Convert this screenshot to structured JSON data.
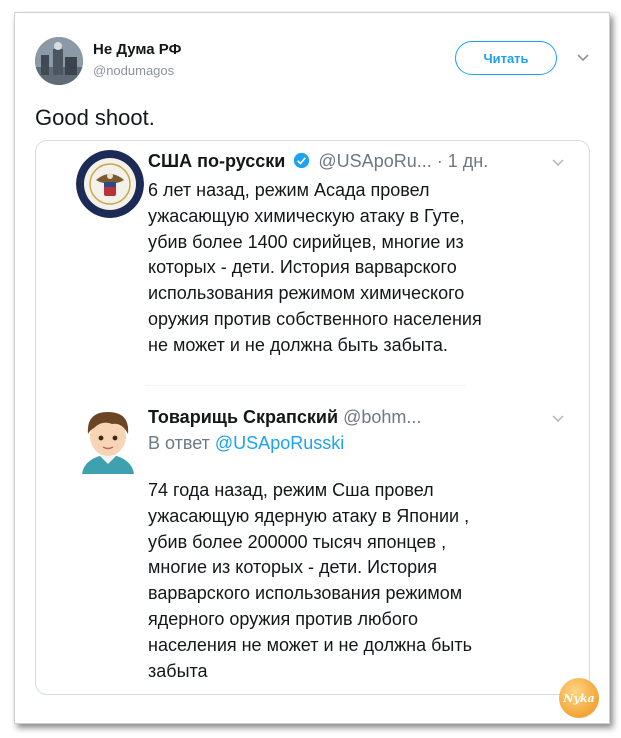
{
  "author": {
    "name": "Не Дума РФ",
    "handle": "@nodumagos"
  },
  "follow_button": {
    "label": "Читать"
  },
  "tweet": {
    "text": "Good shoot."
  },
  "quoted_tweet": {
    "name": "США по-русски",
    "handle": "@USApoRu...",
    "time": "· 1 дн.",
    "lines": [
      "6 лет назад, режим Асада провел",
      "ужасающую химическую атаку в Гуте,",
      "убив более 1400 сирийцев, многие из",
      "которых - дети. История варварского",
      "использования режимом химического",
      "оружия против собственного населения",
      "не может и не должна быть забыта."
    ]
  },
  "reply_tweet": {
    "name": "Товарищь Скрапский",
    "handle": "@bohm...",
    "reply_prefix": "В ответ",
    "reply_to": "@USApoRusski",
    "lines": [
      "74 года назад, режим Сша провел",
      "ужасающую ядерную атаку в Японии ,",
      "убив более 200000 тысяч японцев ,",
      "многие из которых - дети. История",
      "варварского использования режимом",
      "ядерного оружия против любого",
      "населения не может и не должна быть",
      "забыта"
    ]
  },
  "watermark": {
    "text": "Nyka"
  },
  "colors": {
    "accent": "#1da1f2",
    "muted": "#6d7882",
    "text": "#14171a"
  }
}
